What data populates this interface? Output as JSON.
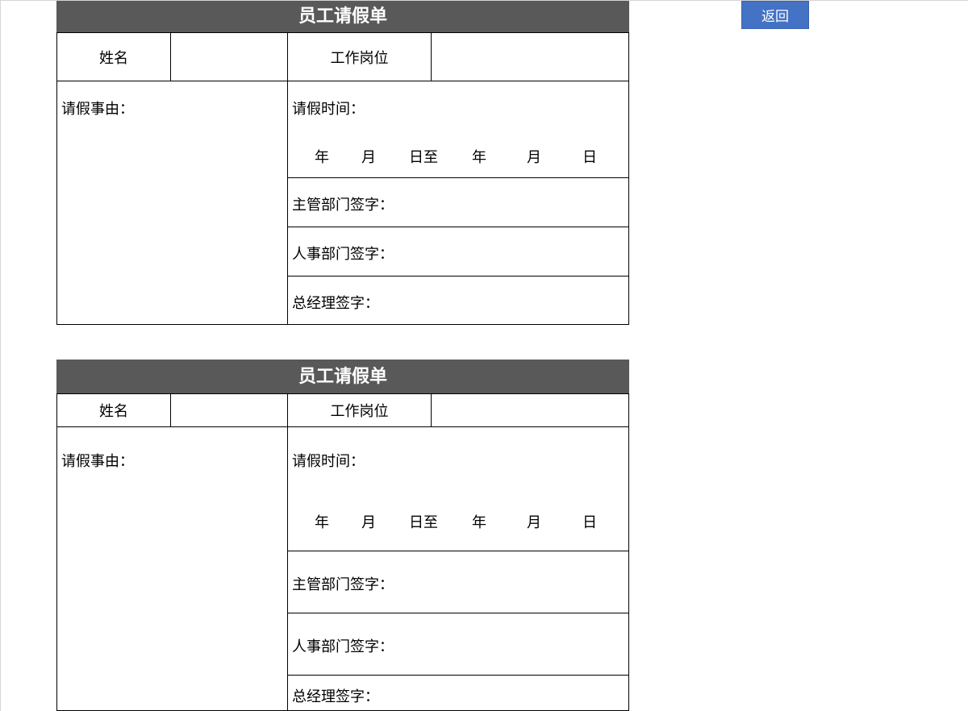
{
  "toolbar": {
    "back_label": "返回"
  },
  "forms": [
    {
      "title": "员工请假单",
      "name_label": "姓名",
      "position_label": "工作岗位",
      "reason_label": "请假事由：",
      "time_label": "请假时间：",
      "date_from_year": "年",
      "date_from_month": "月",
      "date_from_day_to": "日至",
      "date_to_year": "年",
      "date_to_month": "月",
      "date_to_day": "日",
      "supervisor_sign": "主管部门签字：",
      "hr_sign": "人事部门签字：",
      "gm_sign": "总经理签字："
    },
    {
      "title": "员工请假单",
      "name_label": "姓名",
      "position_label": "工作岗位",
      "reason_label": "请假事由：",
      "time_label": "请假时间：",
      "date_from_year": "年",
      "date_from_month": "月",
      "date_from_day_to": "日至",
      "date_to_year": "年",
      "date_to_month": "月",
      "date_to_day": "日",
      "supervisor_sign": "主管部门签字：",
      "hr_sign": "人事部门签字：",
      "gm_sign": "总经理签字："
    }
  ]
}
